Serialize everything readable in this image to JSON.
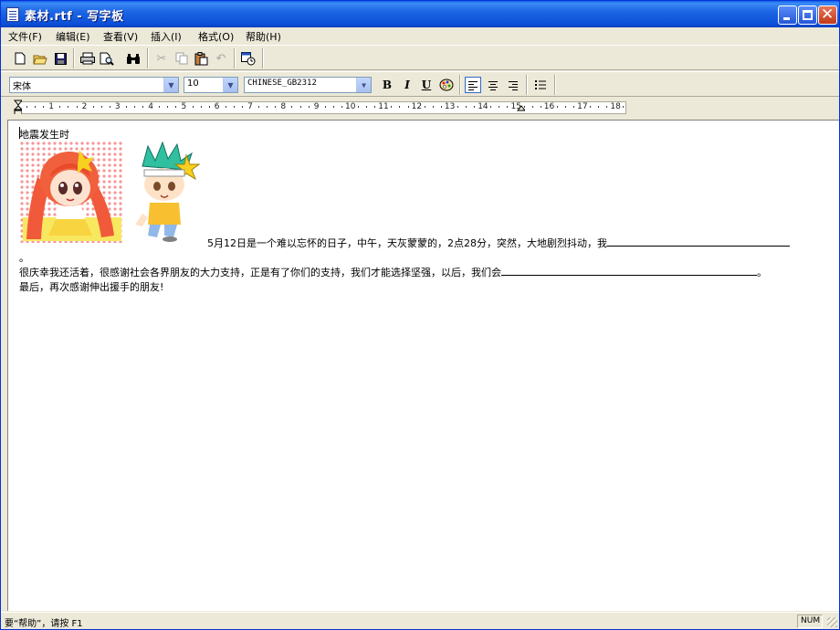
{
  "window": {
    "title": "素材.rtf - 写字板"
  },
  "menu": {
    "items": [
      "文件(F)",
      "编辑(E)",
      "查看(V)",
      "插入(I)",
      "格式(O)",
      "帮助(H)"
    ]
  },
  "toolbar": {
    "icons": [
      "new-icon",
      "open-icon",
      "save-icon",
      "print-icon",
      "print-preview-icon",
      "find-icon",
      "cut-icon",
      "copy-icon",
      "paste-icon",
      "undo-icon",
      "insert-datetime-icon"
    ]
  },
  "format": {
    "font_name": "宋体",
    "font_size": "10",
    "script": "CHINESE_GB2312",
    "bold_label": "B",
    "italic_label": "I",
    "underline_label": "U"
  },
  "ruler": {
    "numbers": [
      "1",
      "2",
      "3",
      "4",
      "5",
      "6",
      "7",
      "8",
      "9",
      "10",
      "11",
      "12",
      "13",
      "14",
      "15",
      "16",
      "17",
      "18"
    ]
  },
  "document": {
    "heading": "地震发生时",
    "line1": "5月12日是一个难以忘怀的日子，中午，天灰蒙蒙的，2点28分，突然，大地剧烈抖动，我",
    "line1_end": "。",
    "line2": "很庆幸我还活着，很感谢社会各界朋友的大力支持，正是有了你们的支持，我们才能选择坚强，以后，我们会",
    "line2_end": "。",
    "line3": "最后，再次感谢伸出援手的朋友!"
  },
  "status": {
    "help_text": "要“帮助”，请按 F1",
    "num_indicator": "NUM"
  },
  "colors": {
    "title_bar": "#0a4fd8",
    "chrome": "#ece9d8",
    "document_bg": "#ffffff"
  }
}
